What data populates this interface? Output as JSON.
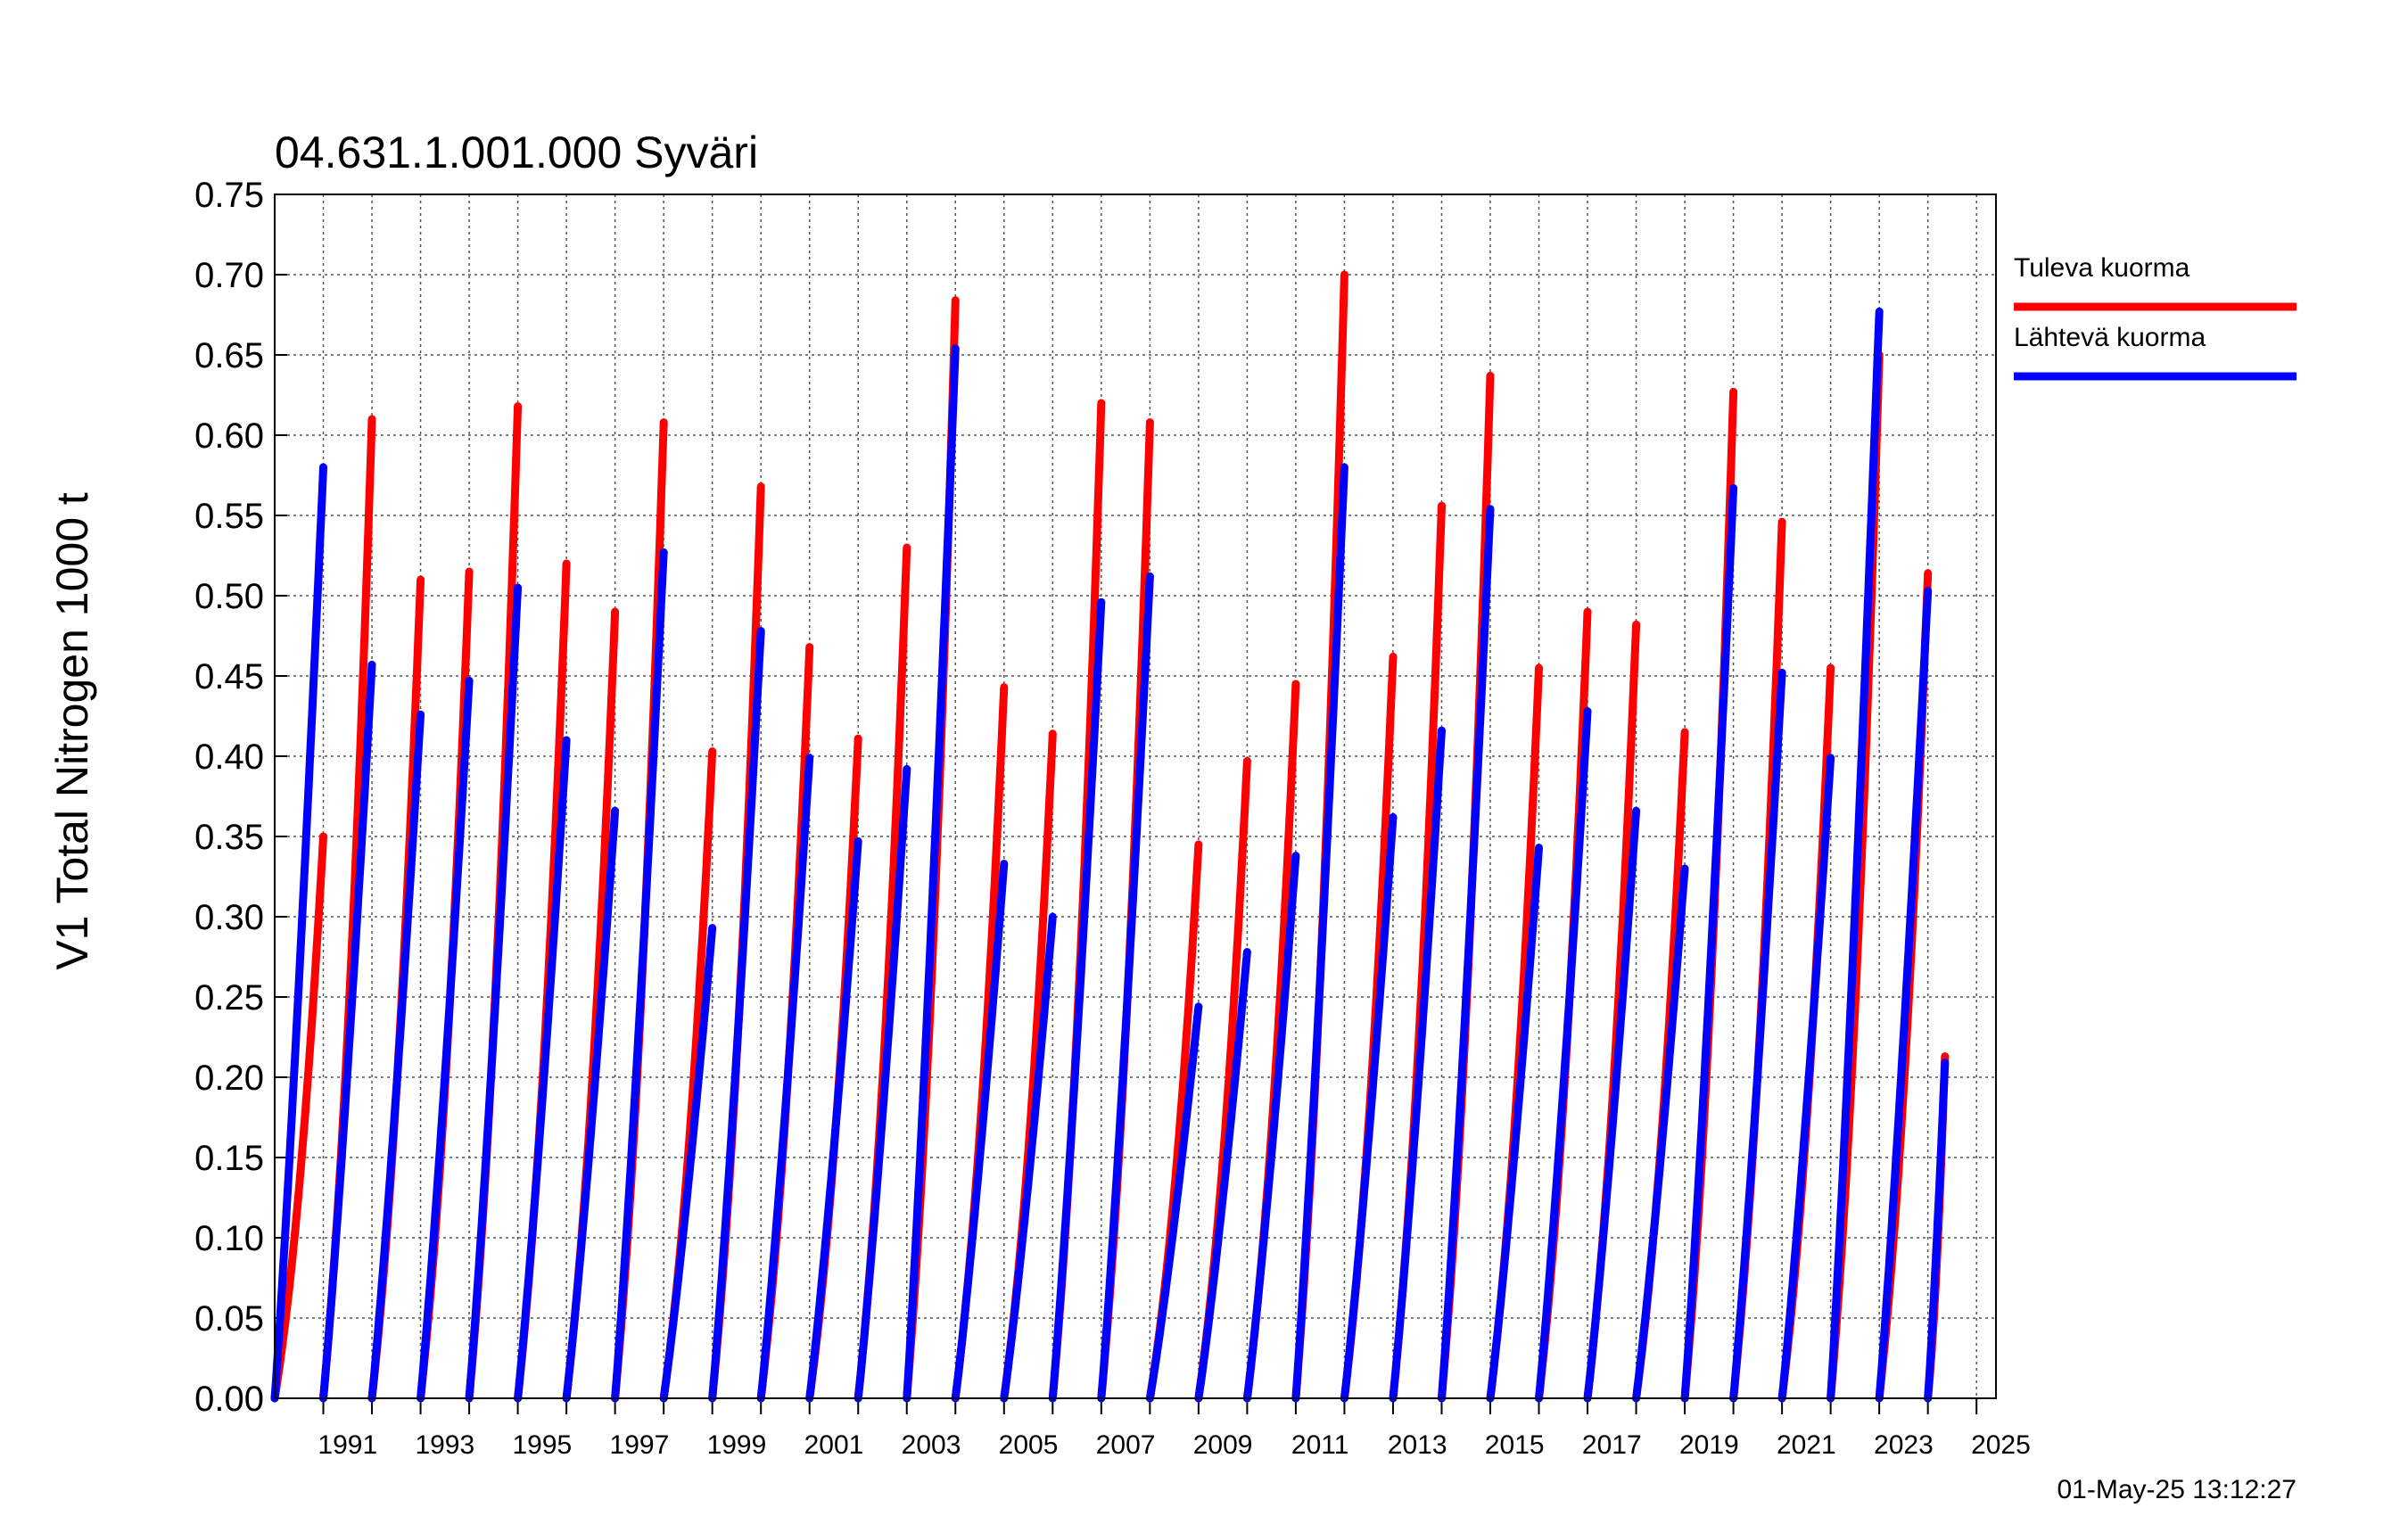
{
  "chart_data": {
    "type": "line",
    "title": "04.631.1.001.000 Syväri",
    "ylabel": "V1 Total Nitrogen 1000 t",
    "xlabel": "",
    "xlim": [
      1990.0,
      2025.4
    ],
    "ylim": [
      0,
      0.75
    ],
    "yticks": [
      "0.00",
      "0.05",
      "0.10",
      "0.15",
      "0.20",
      "0.25",
      "0.30",
      "0.35",
      "0.40",
      "0.45",
      "0.50",
      "0.55",
      "0.60",
      "0.65",
      "0.70",
      "0.75"
    ],
    "xtick_labels": [
      "1991",
      "1993",
      "1995",
      "1997",
      "1999",
      "2001",
      "2003",
      "2005",
      "2007",
      "2009",
      "2011",
      "2013",
      "2015",
      "2017",
      "2019",
      "2021",
      "2023",
      "2025"
    ],
    "grid": true,
    "legend_position": "right",
    "timestamp": "01-May-25 13:12:27",
    "series": [
      {
        "name": "Tuleva kuorma",
        "color": "#ff0000",
        "annual_totals": [
          0.35,
          0.61,
          0.51,
          0.515,
          0.618,
          0.52,
          0.49,
          0.608,
          0.403,
          0.568,
          0.468,
          0.411,
          0.53,
          0.684,
          0.443,
          0.414,
          0.62,
          0.608,
          0.345,
          0.397,
          0.445,
          0.7,
          0.462,
          0.556,
          0.637,
          0.455,
          0.49,
          0.482,
          0.415,
          0.627,
          0.546,
          0.455,
          0.65,
          0.514,
          0.213
        ]
      },
      {
        "name": "Lähtevä kuorma",
        "color": "#0000ff",
        "annual_totals": [
          0.58,
          0.457,
          0.426,
          0.447,
          0.505,
          0.41,
          0.366,
          0.527,
          0.293,
          0.478,
          0.399,
          0.347,
          0.392,
          0.654,
          0.333,
          0.3,
          0.496,
          0.512,
          0.244,
          0.278,
          0.338,
          0.58,
          0.362,
          0.416,
          0.554,
          0.343,
          0.428,
          0.366,
          0.33,
          0.567,
          0.452,
          0.399,
          0.677,
          0.503,
          0.209
        ]
      }
    ]
  }
}
